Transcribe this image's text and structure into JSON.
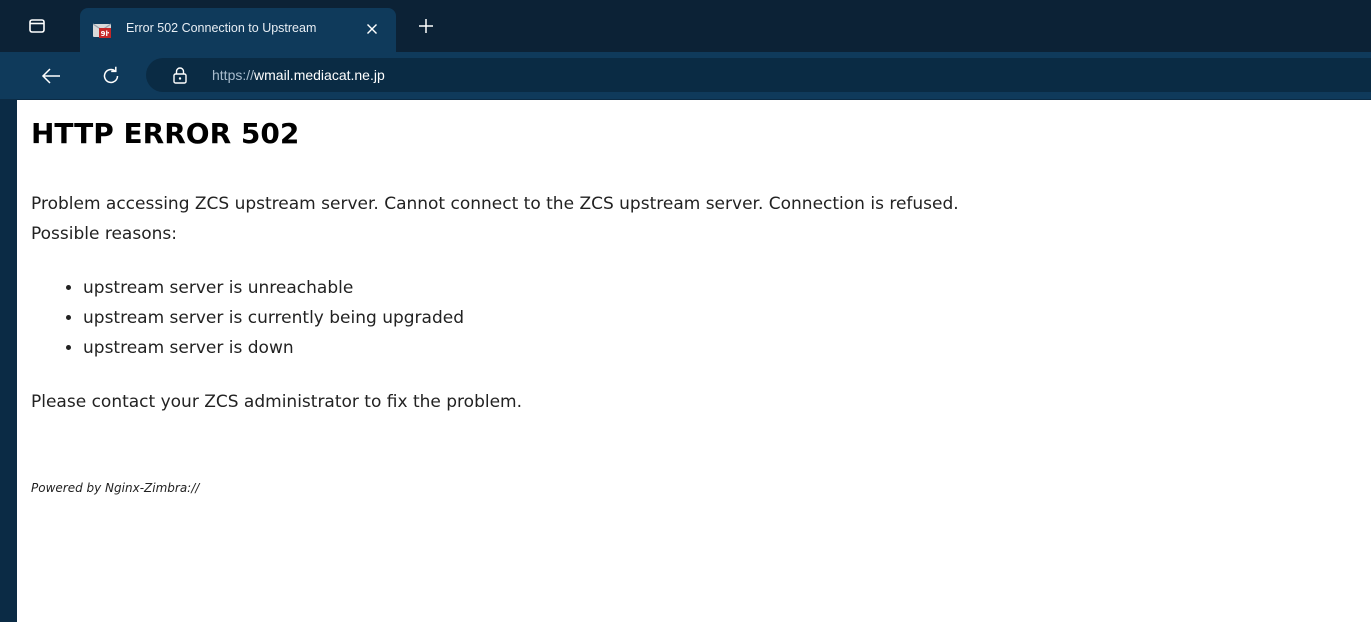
{
  "browser": {
    "tab": {
      "title": "Error 502 Connection to Upstream",
      "favicon": "mail-favicon"
    },
    "tab_actions_icon": "tab-actions-icon",
    "close_tab_icon": "close-icon",
    "new_tab_icon": "plus-icon",
    "back_icon": "back-arrow-icon",
    "refresh_icon": "refresh-icon",
    "lock_icon": "lock-icon",
    "url": {
      "scheme": "https://",
      "host": "wmail.mediacat.ne.jp"
    },
    "colors": {
      "tabbar": "#0c2236",
      "toolbar": "#0f3a5b",
      "omnibox": "#0a2b44"
    }
  },
  "page": {
    "heading": "HTTP ERROR 502",
    "message_line1": "Problem accessing ZCS upstream server. Cannot connect to the ZCS upstream server. Connection is refused.",
    "message_line2": "Possible reasons:",
    "reasons": [
      "upstream server is unreachable",
      "upstream server is currently being upgraded",
      "upstream server is down"
    ],
    "contact": "Please contact your ZCS administrator to fix the problem.",
    "powered_by": "Powered by Nginx-Zimbra://"
  }
}
